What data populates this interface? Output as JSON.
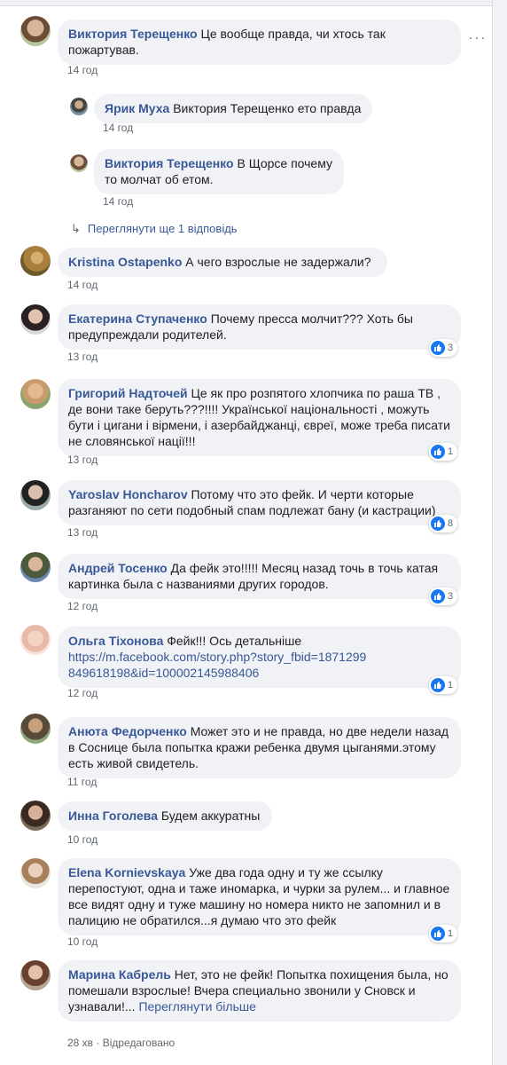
{
  "comments": [
    {
      "author": "Виктория Терещенко",
      "text": "Це вообще правда, чи хтось так пожартував.",
      "time": "14 год"
    },
    {
      "author": "Kristina Ostapenko",
      "text": "А чего взрослые не задержали?",
      "time": "14 год"
    },
    {
      "author": "Екатерина Ступаченко",
      "text": "Почему пресса молчит??? Хоть бы предупреждали родителей.",
      "time": "13 год",
      "reactions": "3"
    },
    {
      "author": "Григорий Надточей",
      "text": "Це як про розпятого хлопчика по раша ТВ , де вони таке беруть???!!!! Української національності , можуть бути і цигани і вірмени, і азербайджанці, євреї, може треба писати не словянської нації!!!",
      "time": "13 год",
      "reactions": "1"
    },
    {
      "author": "Yaroslav Honcharov",
      "text": "Потому что это фейк. И черти которые разганяют по сети подобный спам подлежат бану (и кастрации)",
      "time": "13 год",
      "reactions": "8"
    },
    {
      "author": "Андрей Тосенко",
      "text": "Да фейк это!!!!! Месяц назад точь в точь катая картинка была с названиями других городов.",
      "time": "12 год",
      "reactions": "3"
    },
    {
      "author": "Ольга Тіхонова",
      "text": "Фейк!!! Ось детальніше",
      "link": "https://m.facebook.com/story.php?story_fbid=1871299849618198&id=100002145988406",
      "time": "12 год",
      "reactions": "1"
    },
    {
      "author": "Анюта Федорченко",
      "text": "Может это и не правда, но две недели назад в Соснице была попытка кражи ребенка двумя цыганями.этому есть живой свидетель.",
      "time": "11 год"
    },
    {
      "author": "Инна Гоголева",
      "text": "Будем аккуратны",
      "time": "10 год"
    },
    {
      "author": "Elena Kornievskaya",
      "text": "Уже два года одну и ту же ссылку перепостуют, одна и таже иномарка, и чурки за рулем... и главное все видят одну и туже машину но номера никто не запомнил и в палицию не обратился...я думаю что это фейк",
      "time": "10 год",
      "reactions": "1"
    },
    {
      "author": "Марина Кабрель",
      "text": "Нет, это не фейк! Попытка похищения была, но помешали взрослые! Вчера специально звонили у Сновск и узнавали!...",
      "see_more": "Переглянути більше",
      "time": "28 хв",
      "edited": "Відредаговано"
    }
  ],
  "replies": [
    {
      "author": "Ярик Муха",
      "text": "Виктория Терещенко ето правда",
      "time": "14 год"
    },
    {
      "author": "Виктория Терещенко",
      "text": "В Щорсе почему то молчат об етом.",
      "time": "14 год"
    }
  ],
  "view_more_replies": "Переглянути ще 1 відповідь",
  "dot_separator": "·",
  "colors": {
    "bubble": "#f0f2f5",
    "author": "#385898",
    "meta": "#606770",
    "like": "#1877f2"
  }
}
